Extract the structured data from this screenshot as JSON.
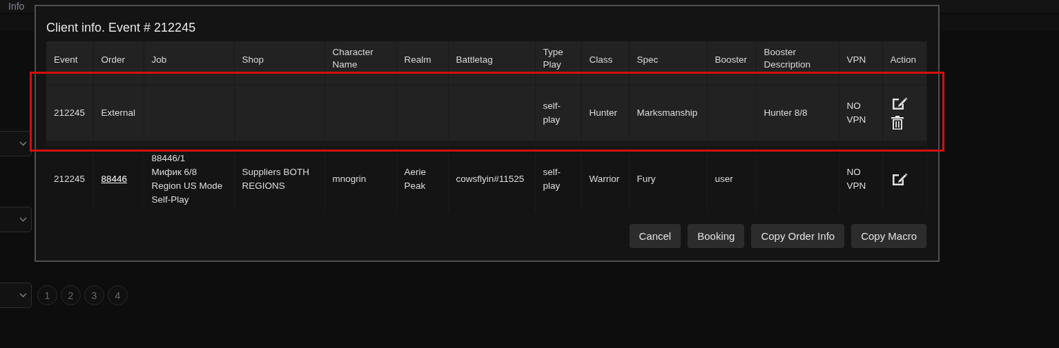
{
  "background": {
    "tabs": [
      {
        "label": "Info"
      }
    ],
    "pages": [
      "1",
      "2",
      "3",
      "4"
    ]
  },
  "modal": {
    "title": "Client info. Event # 212245",
    "table": {
      "columns": [
        "Event",
        "Order",
        "Job",
        "Shop",
        "Character Name",
        "Realm",
        "Battletag",
        "Type Play",
        "Class",
        "Spec",
        "Booster",
        "Booster Description",
        "VPN",
        "Action"
      ],
      "rows": [
        {
          "highlighted": true,
          "order_link": false,
          "cells": [
            "212245",
            "External",
            null,
            null,
            null,
            null,
            null,
            "self-play",
            "Hunter",
            "Marksmanship",
            null,
            "Hunter 8/8",
            "NO VPN"
          ],
          "actions": [
            {
              "kind": "edit"
            },
            {
              "kind": "delete"
            }
          ]
        },
        {
          "highlighted": false,
          "order_link": true,
          "cells": [
            "212245",
            "88446",
            "88446/1\nМифик 6/8\nRegion US Mode\nSelf-Play",
            "Suppliers BOTH REGIONS",
            "mnogrin",
            "Aerie Peak",
            "cowsflyin#11525",
            "self-play",
            "Warrior",
            "Fury",
            "user",
            null,
            "NO VPN"
          ],
          "actions": [
            {
              "kind": "edit"
            }
          ]
        }
      ]
    },
    "buttons": [
      "Cancel",
      "Booking",
      "Copy Order Info",
      "Copy Macro"
    ]
  }
}
